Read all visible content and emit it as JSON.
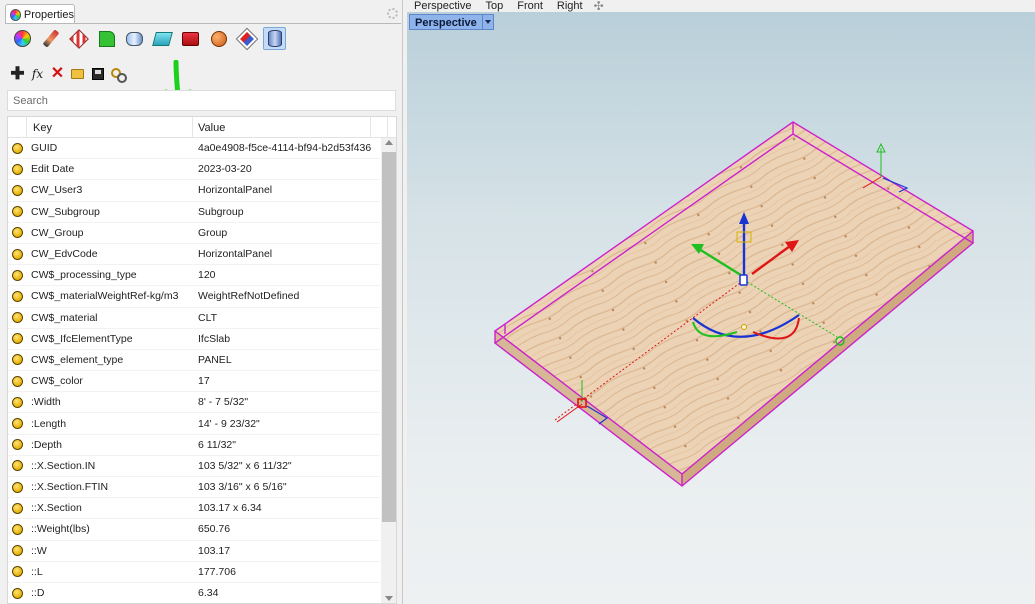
{
  "panel": {
    "tab_label": "Properties",
    "property_page_icons": [
      "object-color-icon",
      "pen-icon",
      "material-icon",
      "decal-icon",
      "render-mesh-icon",
      "shadow-icon",
      "render-icon",
      "texture-icon",
      "display-icon",
      "attribute-user-text-icon"
    ],
    "search_placeholder": "Search",
    "columns": {
      "key": "Key",
      "value": "Value"
    },
    "rows": [
      {
        "key": "GUID",
        "value": "4a0e4908-f5ce-4114-bf94-b2d53f436"
      },
      {
        "key": "Edit Date",
        "value": "2023-03-20"
      },
      {
        "key": "CW_User3",
        "value": "HorizontalPanel"
      },
      {
        "key": "CW_Subgroup",
        "value": "Subgroup"
      },
      {
        "key": "CW_Group",
        "value": "Group"
      },
      {
        "key": "CW_EdvCode",
        "value": "HorizontalPanel"
      },
      {
        "key": "CW$_processing_type",
        "value": "120"
      },
      {
        "key": "CW$_materialWeightRef-kg/m3",
        "value": "WeightRefNotDefined"
      },
      {
        "key": "CW$_material",
        "value": "CLT"
      },
      {
        "key": "CW$_IfcElementType",
        "value": "IfcSlab"
      },
      {
        "key": "CW$_element_type",
        "value": "PANEL"
      },
      {
        "key": "CW$_color",
        "value": "17"
      },
      {
        "key": ":Width",
        "value": "8' - 7 5/32\""
      },
      {
        "key": ":Length",
        "value": "14' - 9 23/32\""
      },
      {
        "key": ":Depth",
        "value": "6 11/32\""
      },
      {
        "key": "::X.Section.IN",
        "value": "103 5/32\" x 6 11/32\""
      },
      {
        "key": "::X.Section.FTIN",
        "value": "103 3/16\" x 6 5/16\""
      },
      {
        "key": "::X.Section",
        "value": "103.17 x 6.34"
      },
      {
        "key": "::Weight(lbs)",
        "value": "650.76"
      },
      {
        "key": "::W",
        "value": "103.17"
      },
      {
        "key": "::L",
        "value": "177.706"
      },
      {
        "key": "::D",
        "value": "6.34"
      }
    ]
  },
  "viewport": {
    "tabs": [
      "Perspective",
      "Top",
      "Front",
      "Right"
    ],
    "active_label": "Perspective"
  },
  "colors": {
    "selection": "#cc22cc",
    "accent": "#8fb4ec",
    "annotation_arrow": "#1bd11b",
    "gumball_x": "#e01515",
    "gumball_y": "#1fbf1f",
    "gumball_z": "#1a34d4"
  }
}
